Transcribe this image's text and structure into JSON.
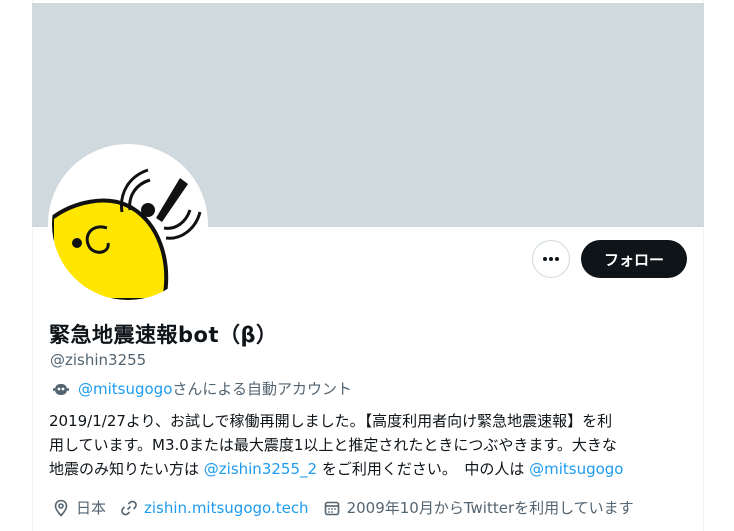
{
  "profile": {
    "name": "緊急地震速報bot（β）",
    "handle": "@zishin3255",
    "automated": {
      "account": "@mitsugogo",
      "suffix": "さんによる自動アカウント"
    },
    "bio": {
      "line1": "2019/1/27より、お試しで稼働再開しました。【高度利用者向け緊急地震速報】を利",
      "line2": "用しています。M3.0または最大震度1以上と推定されたときにつぶやきます。大きな",
      "line3_pre": "地震のみ知りたい方は ",
      "line3_link": "@zishin3255_2",
      "line3_mid": " をご利用ください。　中の人は ",
      "line3_link2": "@mitsugogo"
    },
    "location": "日本",
    "website": "zishin.mitsugogo.tech",
    "joined": "2009年10月からTwitterを利用しています"
  },
  "actions": {
    "more_label": "•••",
    "follow_label": "フォロー"
  },
  "colors": {
    "banner": "#cfd9de",
    "link": "#1d9bf0",
    "follow_bg": "#0f1419",
    "avatar_yellow": "#ffe600"
  }
}
